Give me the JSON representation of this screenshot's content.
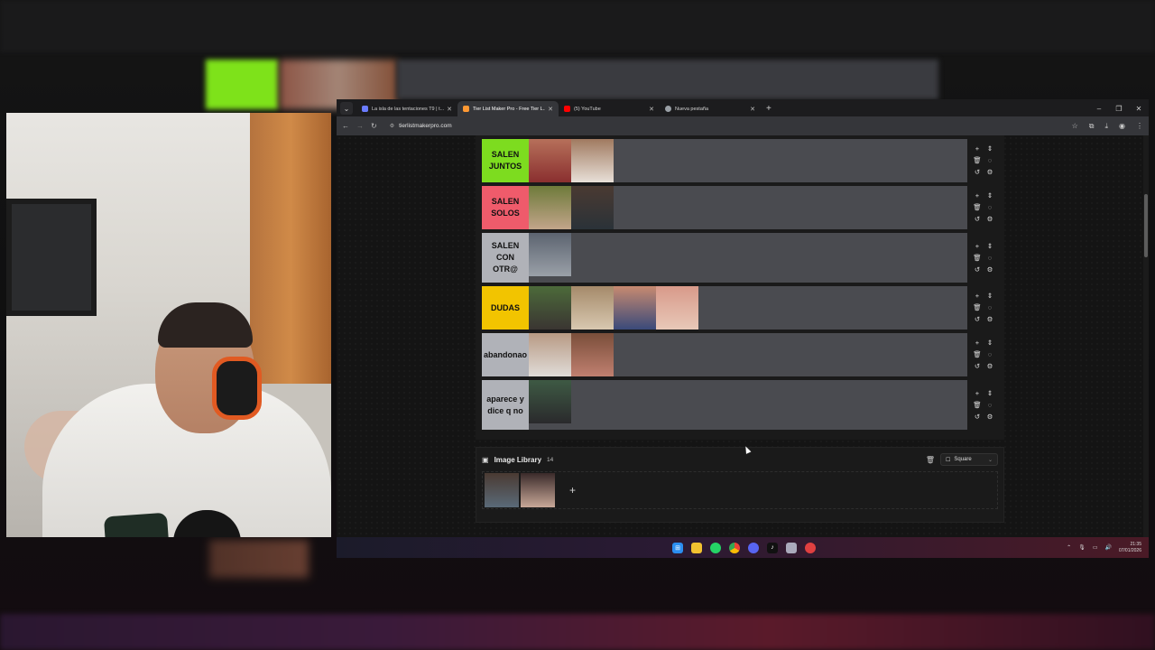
{
  "browser": {
    "tabs": [
      {
        "title": "La isla de las tentaciones T9 | t...",
        "favicon_color": "#6b7cff",
        "active": false
      },
      {
        "title": "Tier List Maker Pro - Free Tier L...",
        "favicon_color": "#ff9933",
        "active": true
      },
      {
        "title": "(5) YouTube",
        "favicon_color": "#ff0000",
        "active": false
      },
      {
        "title": "Nueva pestaña",
        "favicon_color": "#9aa0a6",
        "active": false
      }
    ],
    "url": "tierlistmakerpro.com"
  },
  "tiers": [
    {
      "label": "SALEN JUNTOS",
      "color": "#7ddc1f",
      "images": [
        "#a8574a",
        "#8f6a5a"
      ]
    },
    {
      "label": "SALEN SOLOS",
      "color": "#ef5b6b",
      "images": [
        "#8a7a5a",
        "#5a4a3e"
      ]
    },
    {
      "label": "SALEN CON OTR@",
      "color": "#b0b2b8",
      "images": [
        "#5c6470"
      ]
    },
    {
      "label": "DUDAS",
      "color": "#f2c400",
      "images": [
        "#4c6a3a",
        "#a58a6a",
        "#6a6a8a",
        "#c08a78"
      ]
    },
    {
      "label": "abandonao",
      "color": "#b0b2b8",
      "images": [
        "#b89a84",
        "#7a4e3a"
      ]
    },
    {
      "label": "aparece y dice q no",
      "color": "#b0b2b8",
      "images": [
        "#3e5a44"
      ]
    }
  ],
  "library": {
    "title": "Image Library",
    "count": "14",
    "shape_option": "Square",
    "add": "+",
    "images": [
      "#4a3a32",
      "#5a3a36"
    ]
  },
  "taskbar": {
    "time": "21:35",
    "date": "07/01/2026"
  }
}
